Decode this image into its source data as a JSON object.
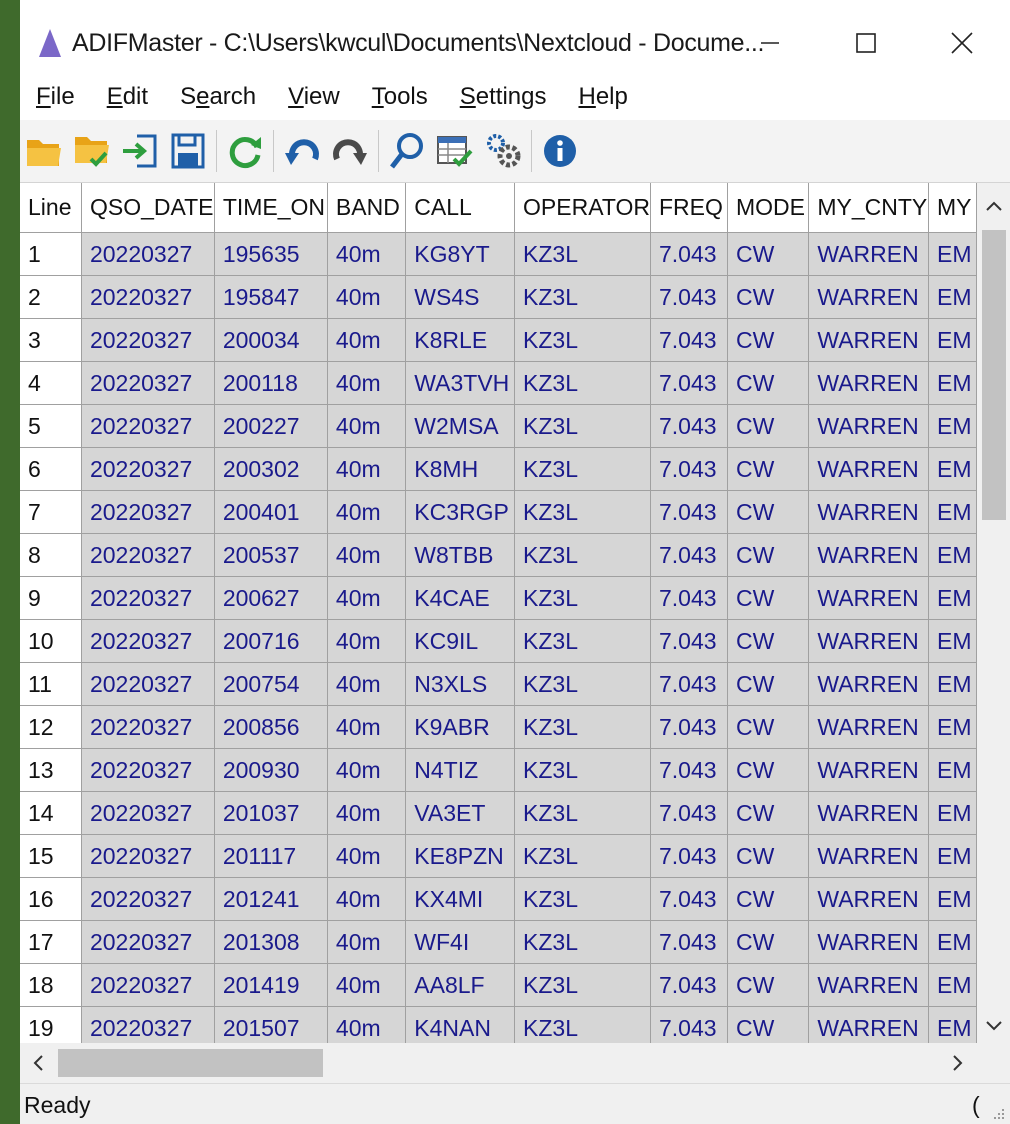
{
  "window": {
    "title": "ADIFMaster - C:\\Users\\kwcul\\Documents\\Nextcloud - Docume...",
    "minimize_glyph": "—",
    "maximize_glyph": "☐",
    "close_glyph": "✕"
  },
  "menu": [
    {
      "mnemonic": "F",
      "rest": "ile"
    },
    {
      "mnemonic": "E",
      "rest": "dit"
    },
    {
      "pre": "S",
      "mnemonic": "e",
      "rest": "arch"
    },
    {
      "mnemonic": "V",
      "rest": "iew"
    },
    {
      "mnemonic": "T",
      "rest": "ools"
    },
    {
      "mnemonic": "S",
      "rest": "ettings"
    },
    {
      "mnemonic": "H",
      "rest": "elp"
    }
  ],
  "toolbar": {
    "icons": [
      "open-folder-icon",
      "open-folder-check-icon",
      "import-icon",
      "save-icon",
      "refresh-icon",
      "undo-icon",
      "redo-icon",
      "search-icon",
      "validate-grid-icon",
      "settings-gears-icon",
      "info-icon"
    ]
  },
  "grid": {
    "columns": [
      "Line",
      "QSO_DATE",
      "TIME_ON",
      "BAND",
      "CALL",
      "OPERATOR",
      "FREQ",
      "MODE",
      "MY_CNTY",
      "MY"
    ],
    "rows": [
      [
        "1",
        "20220327",
        "195635",
        "40m",
        "KG8YT",
        "KZ3L",
        "7.043",
        "CW",
        "WARREN",
        "EM"
      ],
      [
        "2",
        "20220327",
        "195847",
        "40m",
        "WS4S",
        "KZ3L",
        "7.043",
        "CW",
        "WARREN",
        "EM"
      ],
      [
        "3",
        "20220327",
        "200034",
        "40m",
        "K8RLE",
        "KZ3L",
        "7.043",
        "CW",
        "WARREN",
        "EM"
      ],
      [
        "4",
        "20220327",
        "200118",
        "40m",
        "WA3TVH",
        "KZ3L",
        "7.043",
        "CW",
        "WARREN",
        "EM"
      ],
      [
        "5",
        "20220327",
        "200227",
        "40m",
        "W2MSA",
        "KZ3L",
        "7.043",
        "CW",
        "WARREN",
        "EM"
      ],
      [
        "6",
        "20220327",
        "200302",
        "40m",
        "K8MH",
        "KZ3L",
        "7.043",
        "CW",
        "WARREN",
        "EM"
      ],
      [
        "7",
        "20220327",
        "200401",
        "40m",
        "KC3RGP",
        "KZ3L",
        "7.043",
        "CW",
        "WARREN",
        "EM"
      ],
      [
        "8",
        "20220327",
        "200537",
        "40m",
        "W8TBB",
        "KZ3L",
        "7.043",
        "CW",
        "WARREN",
        "EM"
      ],
      [
        "9",
        "20220327",
        "200627",
        "40m",
        "K4CAE",
        "KZ3L",
        "7.043",
        "CW",
        "WARREN",
        "EM"
      ],
      [
        "10",
        "20220327",
        "200716",
        "40m",
        "KC9IL",
        "KZ3L",
        "7.043",
        "CW",
        "WARREN",
        "EM"
      ],
      [
        "11",
        "20220327",
        "200754",
        "40m",
        "N3XLS",
        "KZ3L",
        "7.043",
        "CW",
        "WARREN",
        "EM"
      ],
      [
        "12",
        "20220327",
        "200856",
        "40m",
        "K9ABR",
        "KZ3L",
        "7.043",
        "CW",
        "WARREN",
        "EM"
      ],
      [
        "13",
        "20220327",
        "200930",
        "40m",
        "N4TIZ",
        "KZ3L",
        "7.043",
        "CW",
        "WARREN",
        "EM"
      ],
      [
        "14",
        "20220327",
        "201037",
        "40m",
        "VA3ET",
        "KZ3L",
        "7.043",
        "CW",
        "WARREN",
        "EM"
      ],
      [
        "15",
        "20220327",
        "201117",
        "40m",
        "KE8PZN",
        "KZ3L",
        "7.043",
        "CW",
        "WARREN",
        "EM"
      ],
      [
        "16",
        "20220327",
        "201241",
        "40m",
        "KX4MI",
        "KZ3L",
        "7.043",
        "CW",
        "WARREN",
        "EM"
      ],
      [
        "17",
        "20220327",
        "201308",
        "40m",
        "WF4I",
        "KZ3L",
        "7.043",
        "CW",
        "WARREN",
        "EM"
      ],
      [
        "18",
        "20220327",
        "201419",
        "40m",
        "AA8LF",
        "KZ3L",
        "7.043",
        "CW",
        "WARREN",
        "EM"
      ],
      [
        "19",
        "20220327",
        "201507",
        "40m",
        "K4NAN",
        "KZ3L",
        "7.043",
        "CW",
        "WARREN",
        "EM"
      ]
    ]
  },
  "scrollbars": {
    "up_glyph": "∧",
    "down_glyph": "∨",
    "left_glyph": "<",
    "right_glyph": ">"
  },
  "status": {
    "text": "Ready",
    "right_text": "("
  },
  "colors": {
    "desktop": "#3f6a2c",
    "data_text": "#1a1a8c",
    "data_cell_bg": "#d6d6d6",
    "app_icon": "#7b68c8"
  }
}
